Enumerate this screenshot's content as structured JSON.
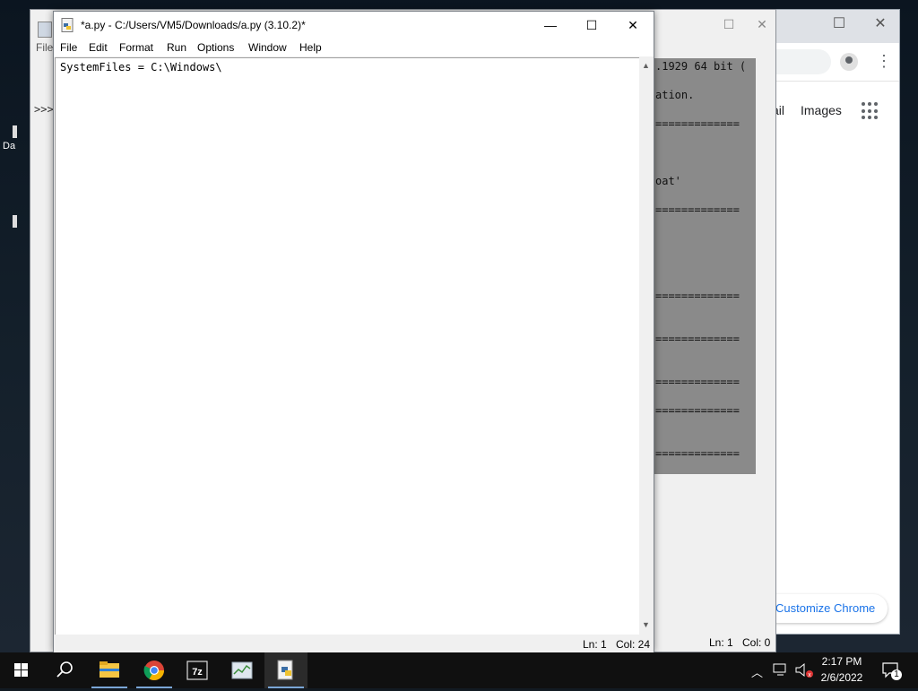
{
  "desktop": {
    "icon_labels": [
      "Da"
    ]
  },
  "chrome": {
    "gmail_partial": "ail",
    "images": "Images",
    "customize": "Customize Chrome",
    "minimize": "—",
    "maximize": "☐",
    "close": "✕"
  },
  "shell": {
    "menu_partial": "File",
    "prompt": ">>>",
    "output_lines": [
      ".1929 64 bit (",
      "ation.",
      "=============",
      "oat'",
      "=============",
      "=============",
      "=============",
      "=============",
      "=============",
      "============="
    ],
    "status_ln": "Ln: 1",
    "status_col": "Col: 0"
  },
  "editor": {
    "title": "*a.py - C:/Users/VM5/Downloads/a.py (3.10.2)*",
    "menus": [
      "File",
      "Edit",
      "Format",
      "Run",
      "Options",
      "Window",
      "Help"
    ],
    "code": "SystemFiles = C:\\Windows\\",
    "status_ln": "Ln: 1",
    "status_col": "Col: 24",
    "minimize": "—",
    "maximize": "☐",
    "close": "✕"
  },
  "taskbar": {
    "items": [
      "start-button",
      "search-icon",
      "file-explorer-icon",
      "chrome-icon",
      "7zip-icon",
      "task-manager-icon",
      "python-idle-icon"
    ],
    "time": "2:17 PM",
    "date": "2/6/2022",
    "notification_count": "1"
  }
}
